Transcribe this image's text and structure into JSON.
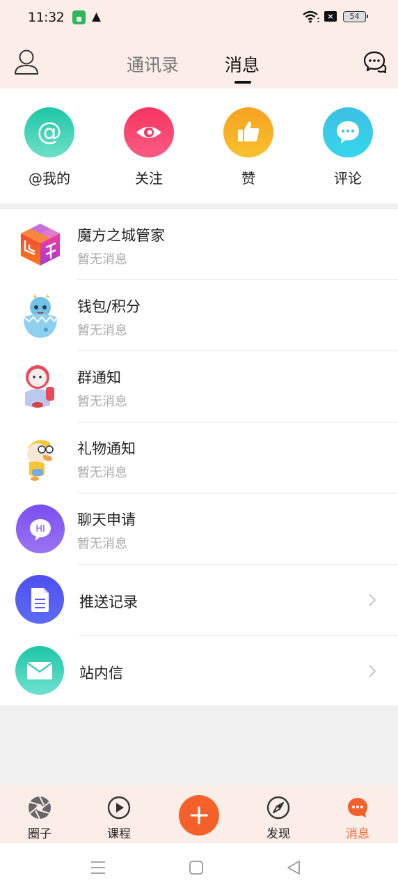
{
  "status_bar": {
    "time": "11:32",
    "warning_glyph": "▲",
    "sim_glyph": "×",
    "battery": "54"
  },
  "header": {
    "tabs": [
      {
        "label": "通讯录",
        "active": false
      },
      {
        "label": "消息",
        "active": true
      }
    ],
    "left_icon": "profile-icon",
    "right_icon": "chat-bubbles-icon"
  },
  "quick_actions": [
    {
      "label": "@我的",
      "icon": "at-icon",
      "color": "#1ec6a6"
    },
    {
      "label": "关注",
      "icon": "eye-icon",
      "color": "#f6345f"
    },
    {
      "label": "赞",
      "icon": "thumbs-up-icon",
      "color": "#f7a221"
    },
    {
      "label": "评论",
      "icon": "comment-icon",
      "color": "#3cc0e3"
    }
  ],
  "messages": [
    {
      "title": "魔方之城管家",
      "subtitle": "暂无消息",
      "avatar": "rubik-cube-avatar"
    },
    {
      "title": "钱包/积分",
      "subtitle": "暂无消息",
      "avatar": "dragon-egg-avatar"
    },
    {
      "title": "群通知",
      "subtitle": "暂无消息",
      "avatar": "astronaut-avatar"
    },
    {
      "title": "礼物通知",
      "subtitle": "暂无消息",
      "avatar": "duck-avatar"
    },
    {
      "title": "聊天申请",
      "subtitle": "暂无消息",
      "avatar": "hi-bubble-avatar",
      "avatar_text": "HI"
    }
  ],
  "links": [
    {
      "title": "推送记录",
      "icon": "document-icon",
      "color": "#5559ef"
    },
    {
      "title": "站内信",
      "icon": "envelope-icon",
      "color": "#1ec6a6"
    }
  ],
  "bottom_nav": [
    {
      "label": "圈子",
      "icon": "aperture-icon",
      "active": false
    },
    {
      "label": "课程",
      "icon": "play-circle-icon",
      "active": false
    },
    {
      "label": "",
      "icon": "plus-icon",
      "active": false
    },
    {
      "label": "发现",
      "icon": "compass-icon",
      "active": false
    },
    {
      "label": "消息",
      "icon": "message-dots-icon",
      "active": true
    }
  ],
  "colors": {
    "accent": "#f4602a",
    "header_bg": "#fbede8"
  }
}
